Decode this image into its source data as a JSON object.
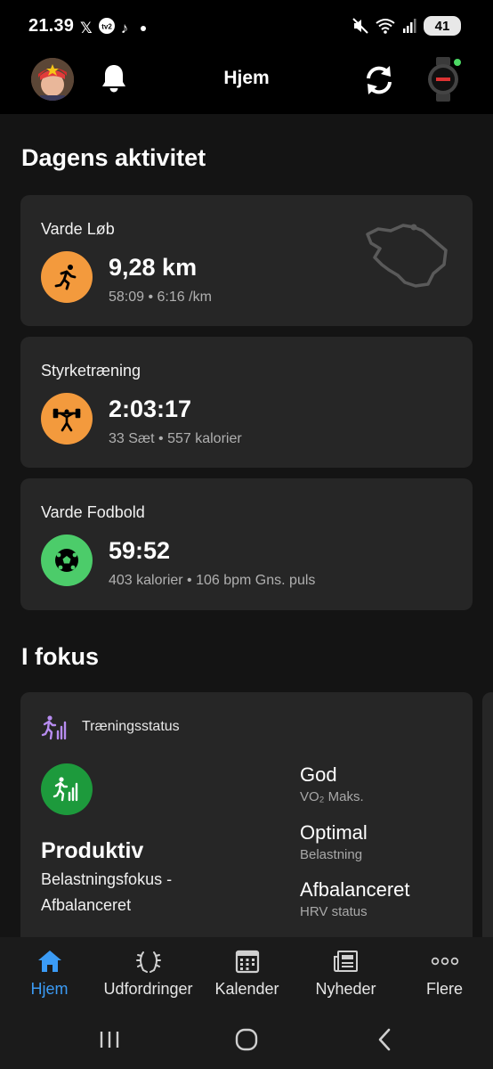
{
  "status_bar": {
    "time": "21.39",
    "apps": [
      "𝕏",
      "tv2",
      "♪"
    ],
    "battery": "41"
  },
  "header": {
    "title": "Hjem"
  },
  "today": {
    "title": "Dagens aktivitet",
    "activities": [
      {
        "name": "Varde Løb",
        "value": "9,28 km",
        "detail": "58:09 • 6:16 /km",
        "icon": "running-icon",
        "color": "#f39a3d"
      },
      {
        "name": "Styrketræning",
        "value": "2:03:17",
        "detail": "33 Sæt • 557 kalorier",
        "icon": "weightlifting-icon",
        "color": "#f39a3d"
      },
      {
        "name": "Varde Fodbold",
        "value": "59:52",
        "detail": "403 kalorier • 106 bpm Gns. puls",
        "icon": "soccer-ball-icon",
        "color": "#4ccc6a"
      }
    ]
  },
  "focus": {
    "title": "I fokus",
    "card": {
      "heading": "Træningsstatus",
      "status": "Produktiv",
      "description": "Belastningsfokus - Afbalanceret",
      "metrics": [
        {
          "value": "God",
          "label": "VO₂ Maks."
        },
        {
          "value": "Optimal",
          "label": "Belastning"
        },
        {
          "value": "Afbalanceret",
          "label": "HRV status"
        }
      ]
    }
  },
  "bottom_nav": {
    "items": [
      {
        "label": "Hjem",
        "icon": "home-icon",
        "active": true
      },
      {
        "label": "Udfordringer",
        "icon": "laurel-icon",
        "active": false
      },
      {
        "label": "Kalender",
        "icon": "calendar-icon",
        "active": false
      },
      {
        "label": "Nyheder",
        "icon": "newspaper-icon",
        "active": false
      },
      {
        "label": "Flere",
        "icon": "more-dots-icon",
        "active": false
      }
    ]
  },
  "colors": {
    "accent": "#3b9bf5",
    "orange": "#f39a3d",
    "green": "#4ccc6a",
    "status_green": "#1d9a3c",
    "card_bg": "#262626"
  }
}
